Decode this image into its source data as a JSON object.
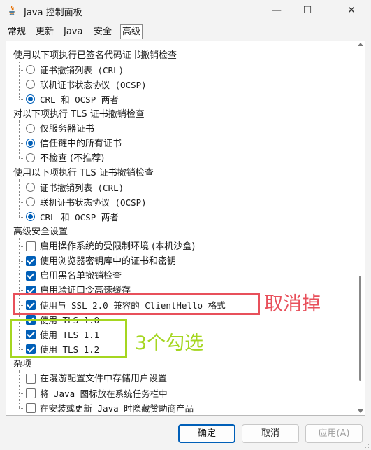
{
  "window": {
    "title": "Java 控制面板"
  },
  "tabs": [
    {
      "label": "常规"
    },
    {
      "label": "更新"
    },
    {
      "label": "Java"
    },
    {
      "label": "安全"
    },
    {
      "label": "高级"
    }
  ],
  "tree": [
    {
      "type": "header",
      "label": "使用以下项执行已签名代码证书撤销检查"
    },
    {
      "type": "radio",
      "label": "证书撤销列表 (CRL)",
      "selected": false
    },
    {
      "type": "radio",
      "label": "联机证书状态协议 (OCSP)",
      "selected": false
    },
    {
      "type": "radio",
      "label": "CRL 和 OCSP 两者",
      "selected": true
    },
    {
      "type": "header",
      "label": "对以下项执行 TLS 证书撤销检查"
    },
    {
      "type": "radio",
      "label": "仅服务器证书",
      "selected": false
    },
    {
      "type": "radio",
      "label": "信任链中的所有证书",
      "selected": true
    },
    {
      "type": "radio",
      "label": "不检查 (不推荐)",
      "selected": false
    },
    {
      "type": "header",
      "label": "使用以下项执行 TLS 证书撤销检查"
    },
    {
      "type": "radio",
      "label": "证书撤销列表 (CRL)",
      "selected": false
    },
    {
      "type": "radio",
      "label": "联机证书状态协议 (OCSP)",
      "selected": false
    },
    {
      "type": "radio",
      "label": "CRL 和 OCSP 两者",
      "selected": true
    },
    {
      "type": "header",
      "label": "高级安全设置"
    },
    {
      "type": "checkbox",
      "label": "启用操作系统的受限制环境 (本机沙盒)",
      "checked": false
    },
    {
      "type": "checkbox",
      "label": "使用浏览器密钥库中的证书和密钥",
      "checked": true
    },
    {
      "type": "checkbox",
      "label": "启用黑名单撤销检查",
      "checked": true
    },
    {
      "type": "checkbox",
      "label": "启用验证口令高速缓存",
      "checked": true
    },
    {
      "type": "checkbox",
      "label": "使用与 SSL 2.0 兼容的 ClientHello 格式",
      "checked": true
    },
    {
      "type": "checkbox",
      "label": "使用 TLS 1.0",
      "checked": true
    },
    {
      "type": "checkbox",
      "label": "使用 TLS 1.1",
      "checked": true
    },
    {
      "type": "checkbox",
      "label": "使用 TLS 1.2",
      "checked": true
    },
    {
      "type": "header",
      "label": "杂项"
    },
    {
      "type": "checkbox",
      "label": "在漫游配置文件中存储用户设置",
      "checked": false
    },
    {
      "type": "checkbox",
      "label": "将 Java 图标放在系统任务栏中",
      "checked": false
    },
    {
      "type": "checkbox",
      "label": "在安装或更新 Java 时隐藏赞助商产品",
      "checked": false
    }
  ],
  "buttons": {
    "ok": "确定",
    "cancel": "取消",
    "apply": "应用(A)"
  },
  "annotations": {
    "remove": "取消掉",
    "three_checked": "3个勾选"
  },
  "colors": {
    "accent": "#005fb8",
    "annotation_red": "#e8505b",
    "annotation_green": "#a5d620"
  }
}
